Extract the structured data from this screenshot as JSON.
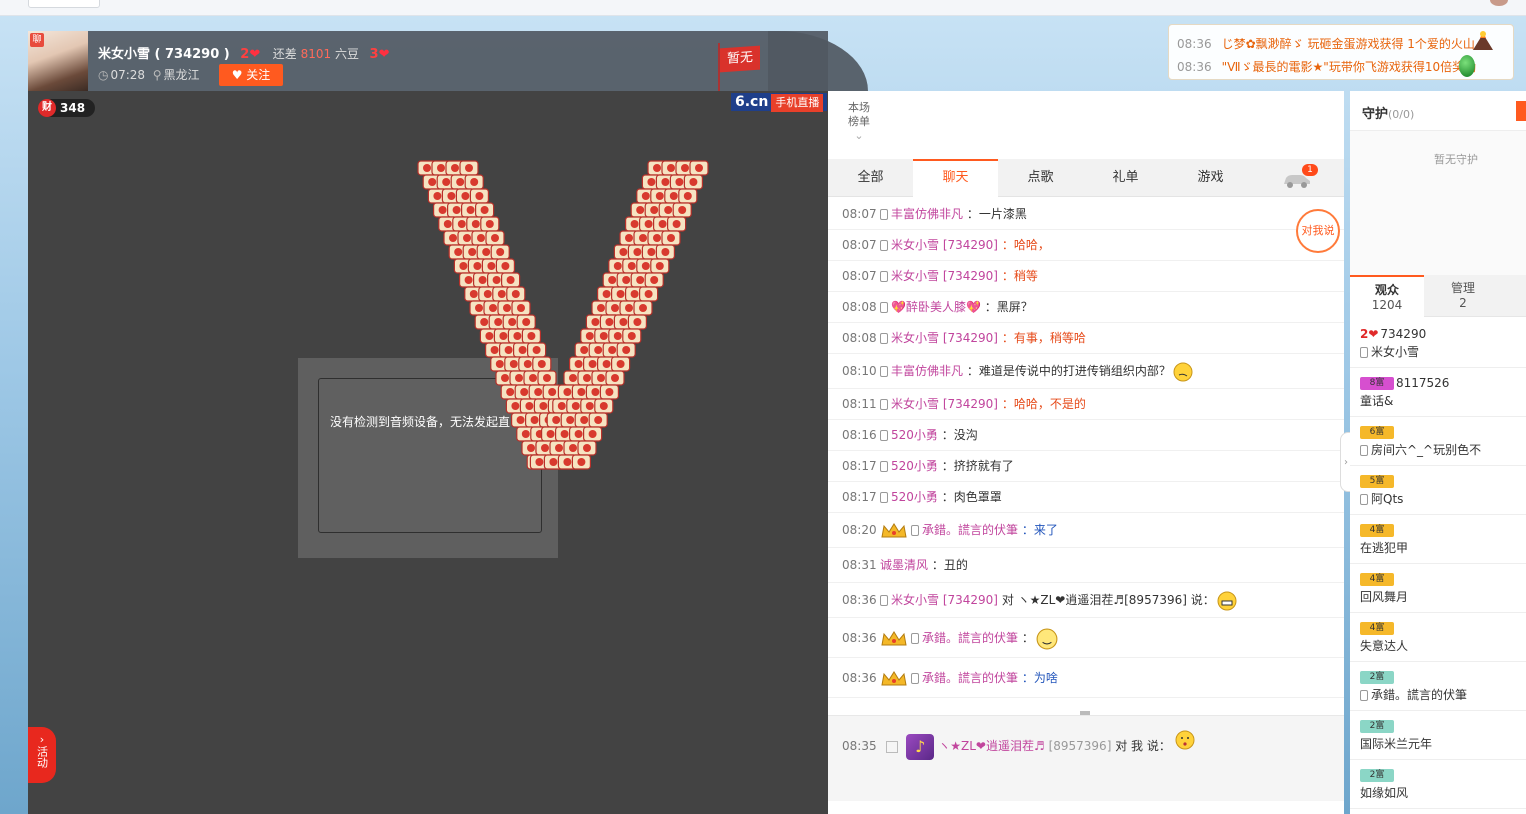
{
  "host": {
    "name": "米女小雪 ( 734290 )",
    "level": "2",
    "diff_prefix": "还差",
    "diff_num": "8101",
    "diff_suffix": "六豆",
    "next_level": "3",
    "time": "07:28",
    "location": "黑龙江",
    "follow_label": "关注",
    "flag_label": "暂无",
    "avatar_tag": "聊"
  },
  "notifications": [
    {
      "time": "08:36",
      "text": "じ梦✿飘渺醉ゞ 玩砸金蛋游戏获得 1个爱的火山"
    },
    {
      "time": "08:36",
      "text": "\"Ⅶゞ最長的電影★\"玩带你飞游戏获得10倍奖励"
    }
  ],
  "video": {
    "wealth_icon": "财",
    "wealth_value": "348",
    "brand": "6.cn",
    "brand_sub": "手机直播",
    "device_message": "没有检测到音频设备，无法发起直",
    "activity_label": "活动"
  },
  "chat": {
    "rank_label_1": "本场",
    "rank_label_2": "榜单",
    "tabs": [
      "全部",
      "聊天",
      "点歌",
      "礼单",
      "游戏"
    ],
    "active_tab": 1,
    "car_badge": "1",
    "talk_button": "对我说",
    "messages": [
      {
        "time": "08:07",
        "user": "丰富仿佛非凡",
        "text": "：一片漆黑",
        "style": "normal"
      },
      {
        "time": "08:07",
        "user": "米女小雪 [734290]",
        "text": "：哈哈，",
        "style": "red"
      },
      {
        "time": "08:07",
        "user": "米女小雪 [734290]",
        "text": "：稍等",
        "style": "red"
      },
      {
        "time": "08:08",
        "user": "💖醉卧美人膝💖",
        "text": "：黑屏？",
        "style": "normal"
      },
      {
        "time": "08:08",
        "user": "米女小雪 [734290]",
        "text": "：有事，稍等哈",
        "style": "red"
      },
      {
        "time": "08:10",
        "user": "丰富仿佛非凡",
        "text": "：难道是传说中的打进传销组织内部？",
        "style": "normal"
      },
      {
        "time": "08:11",
        "user": "米女小雪 [734290]",
        "text": "：哈哈，不是的",
        "style": "red"
      },
      {
        "time": "08:16",
        "user": "520小勇",
        "text": "：没沟",
        "style": "normal"
      },
      {
        "time": "08:17",
        "user": "520小勇",
        "text": "：挤挤就有了",
        "style": "normal"
      },
      {
        "time": "08:17",
        "user": "520小勇",
        "text": "：肉色罩罩",
        "style": "normal"
      },
      {
        "time": "08:20",
        "user": "承錯。謊言的伏筆",
        "text": "：来了",
        "style": "blue"
      },
      {
        "time": "08:31",
        "user": "诚墨清风",
        "text": "：丑的",
        "style": "normal"
      },
      {
        "time": "08:36",
        "user": "米女小雪 [734290]",
        "text": "对 ヽ★ZL❤逍遥泪茬♬[8957396] 说：",
        "style": "normal"
      },
      {
        "time": "08:36",
        "user": "承錯。謊言的伏筆",
        "text": "：",
        "style": "normal"
      },
      {
        "time": "08:36",
        "user": "承錯。謊言的伏筆",
        "text": "：为啥",
        "style": "blue"
      }
    ],
    "private": {
      "time": "08:35",
      "user": "ヽ★ZL❤逍遥泪茬♬",
      "id": "[8957396]",
      "text": "对 我 说："
    }
  },
  "guard": {
    "title": "守护",
    "count": "(0/0)",
    "empty": "暂无守护"
  },
  "audience": {
    "tab_audience": "观众",
    "audience_count": "1204",
    "tab_admin": "管理",
    "admin_count": "2",
    "items": [
      {
        "badge": "2❤",
        "id": "734290",
        "nick": "米女小雪",
        "phone": true,
        "badge_color": "#ffffff"
      },
      {
        "badge": "8富",
        "id": "8117526",
        "nick": "童话&",
        "phone": false,
        "badge_color": "#d64fcf"
      },
      {
        "badge": "6富",
        "id": "",
        "nick": "房间六^_^玩别色不",
        "phone": true,
        "badge_color": "#f5b82a"
      },
      {
        "badge": "5富",
        "id": "",
        "nick": "阿Qts",
        "phone": true,
        "badge_color": "#f5b82a"
      },
      {
        "badge": "4富",
        "id": "",
        "nick": "在逃犯甲",
        "phone": false,
        "badge_color": "#f5b82a"
      },
      {
        "badge": "4富",
        "id": "",
        "nick": "回风舞月",
        "phone": false,
        "badge_color": "#f5b82a"
      },
      {
        "badge": "4富",
        "id": "",
        "nick": "失意达人",
        "phone": false,
        "badge_color": "#f5b82a"
      },
      {
        "badge": "2富",
        "id": "",
        "nick": "承錯。謊言的伏筆",
        "phone": true,
        "badge_color": "#8bd6c6"
      },
      {
        "badge": "2富",
        "id": "",
        "nick": "国际米兰元年",
        "phone": false,
        "badge_color": "#8bd6c6"
      },
      {
        "badge": "2富",
        "id": "",
        "nick": "如缘如风",
        "phone": false,
        "badge_color": "#8bd6c6"
      }
    ]
  }
}
